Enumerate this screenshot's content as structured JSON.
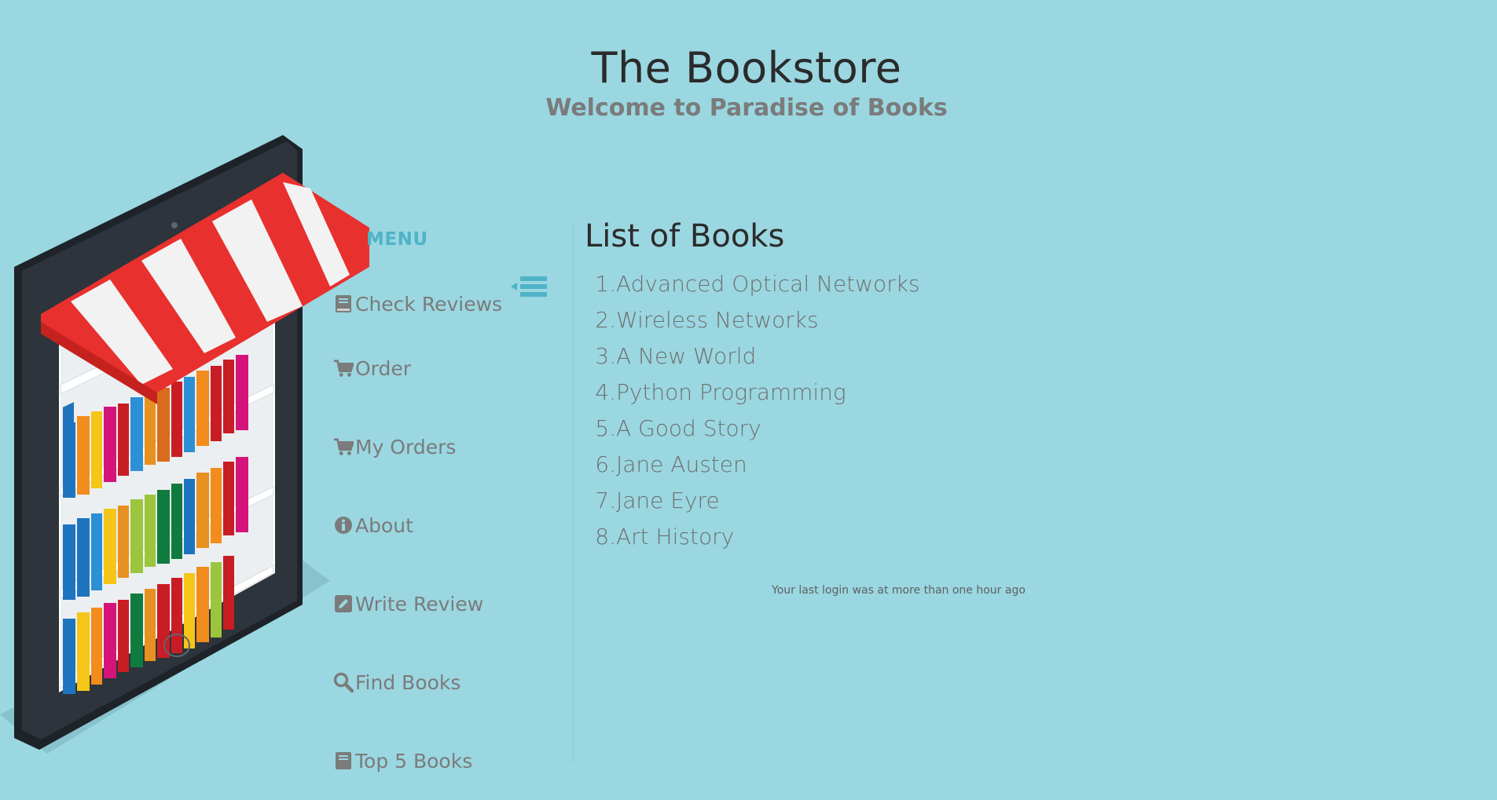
{
  "header": {
    "title": "The Bookstore",
    "subtitle": "Welcome to Paradise of Books"
  },
  "sidebar": {
    "menu_label": "MENU",
    "items": [
      {
        "label": "Check Reviews",
        "icon": "book-icon"
      },
      {
        "label": "Order",
        "icon": "cart-icon"
      },
      {
        "label": "My Orders",
        "icon": "cart-icon"
      },
      {
        "label": "About",
        "icon": "info-icon"
      },
      {
        "label": "Write Review",
        "icon": "edit-icon"
      },
      {
        "label": "Find Books",
        "icon": "search-icon"
      },
      {
        "label": "Top 5 Books",
        "icon": "book-icon"
      }
    ]
  },
  "main": {
    "heading": "List of Books",
    "books": [
      "Advanced Optical Networks",
      "Wireless Networks",
      "A New World",
      "Python Programming",
      "A Good Story",
      "Jane Austen",
      "Jane Eyre",
      "Art History"
    ],
    "login_note": "Your last login was at more than one hour ago"
  },
  "colors": {
    "background": "#9ad7e1",
    "accent": "#4fb3c7",
    "text_dark": "#2b2b2b",
    "text_muted": "#7b7b7b"
  }
}
